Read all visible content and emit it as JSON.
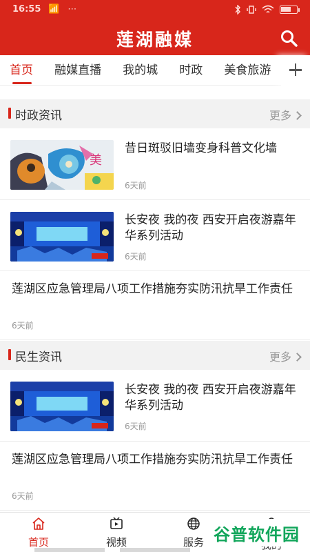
{
  "status_bar": {
    "time": "16:55",
    "left_icons": "📶 ⋯",
    "battery_text": ""
  },
  "header": {
    "app_title": "莲湖融媒"
  },
  "tabs": [
    {
      "label": "首页",
      "active": true
    },
    {
      "label": "融媒直播",
      "active": false
    },
    {
      "label": "我的城",
      "active": false
    },
    {
      "label": "时政",
      "active": false
    },
    {
      "label": "美食旅游",
      "active": false
    }
  ],
  "sections": [
    {
      "title": "时政资讯",
      "more_label": "更多",
      "items": [
        {
          "title": "昔日斑驳旧墙变身科普文化墙",
          "time": "6天前",
          "has_image": true,
          "image": "mural"
        },
        {
          "title": "长安夜 我的夜 西安开启夜游嘉年华系列活动",
          "time": "6天前",
          "has_image": true,
          "image": "stage"
        },
        {
          "title": "莲湖区应急管理局八项工作措施夯实防汛抗旱工作责任",
          "time": "6天前",
          "has_image": false
        }
      ]
    },
    {
      "title": "民生资讯",
      "more_label": "更多",
      "items": [
        {
          "title": "长安夜 我的夜 西安开启夜游嘉年华系列活动",
          "time": "6天前",
          "has_image": true,
          "image": "stage"
        },
        {
          "title": "莲湖区应急管理局八项工作措施夯实防汛抗旱工作责任",
          "time": "6天前",
          "has_image": false
        }
      ]
    }
  ],
  "bottom_nav": [
    {
      "label": "首页",
      "icon": "home-icon",
      "active": true
    },
    {
      "label": "视频",
      "icon": "video-icon",
      "active": false
    },
    {
      "label": "服务",
      "icon": "globe-icon",
      "active": false
    },
    {
      "label": "我的",
      "icon": "user-icon",
      "active": false
    }
  ],
  "watermark": {
    "text": "谷普软件园"
  },
  "colors": {
    "brand_red": "#d8261b",
    "watermark_green": "#12a65b"
  }
}
